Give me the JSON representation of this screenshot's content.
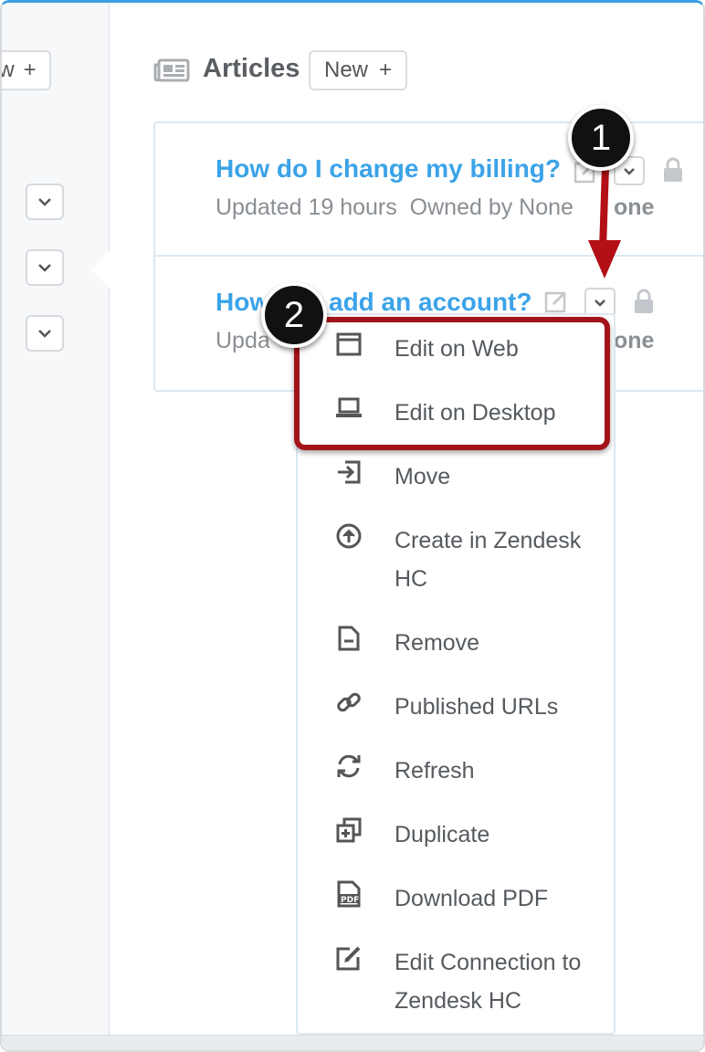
{
  "sidebar": {
    "new_button": {
      "label": "w",
      "plus": "+"
    }
  },
  "header": {
    "icon": "newspaper-icon",
    "title": "Articles",
    "new_label": "New",
    "new_plus": "+"
  },
  "articles": [
    {
      "title": "How do I change my billing?",
      "updated": "Updated 19 hours",
      "owned": "Owned by None",
      "owner_tail": "one"
    },
    {
      "title_left": "How",
      "title_right": "add an account?",
      "updated": "Upda",
      "owner_tail": "one"
    }
  ],
  "menu": {
    "items": [
      {
        "label": "Edit on Web",
        "icon": "browser-window-icon"
      },
      {
        "label": "Edit on Desktop",
        "icon": "laptop-icon"
      },
      {
        "label": "Move",
        "icon": "move-in-icon"
      },
      {
        "label": "Create in Zendesk HC",
        "icon": "upload-circle-icon"
      },
      {
        "label": "Remove",
        "icon": "document-minus-icon"
      },
      {
        "label": "Published URLs",
        "icon": "link-icon"
      },
      {
        "label": "Refresh",
        "icon": "refresh-icon"
      },
      {
        "label": "Duplicate",
        "icon": "duplicate-icon"
      },
      {
        "label": "Download PDF",
        "icon": "pdf-file-icon"
      },
      {
        "label": "Edit Connection to Zendesk HC",
        "icon": "edit-square-icon"
      }
    ]
  },
  "callouts": [
    {
      "number": "1"
    },
    {
      "number": "2"
    }
  ],
  "colors": {
    "accent": "#3ba3e8",
    "highlight": "#a3131a",
    "arrow": "#b30f16"
  }
}
